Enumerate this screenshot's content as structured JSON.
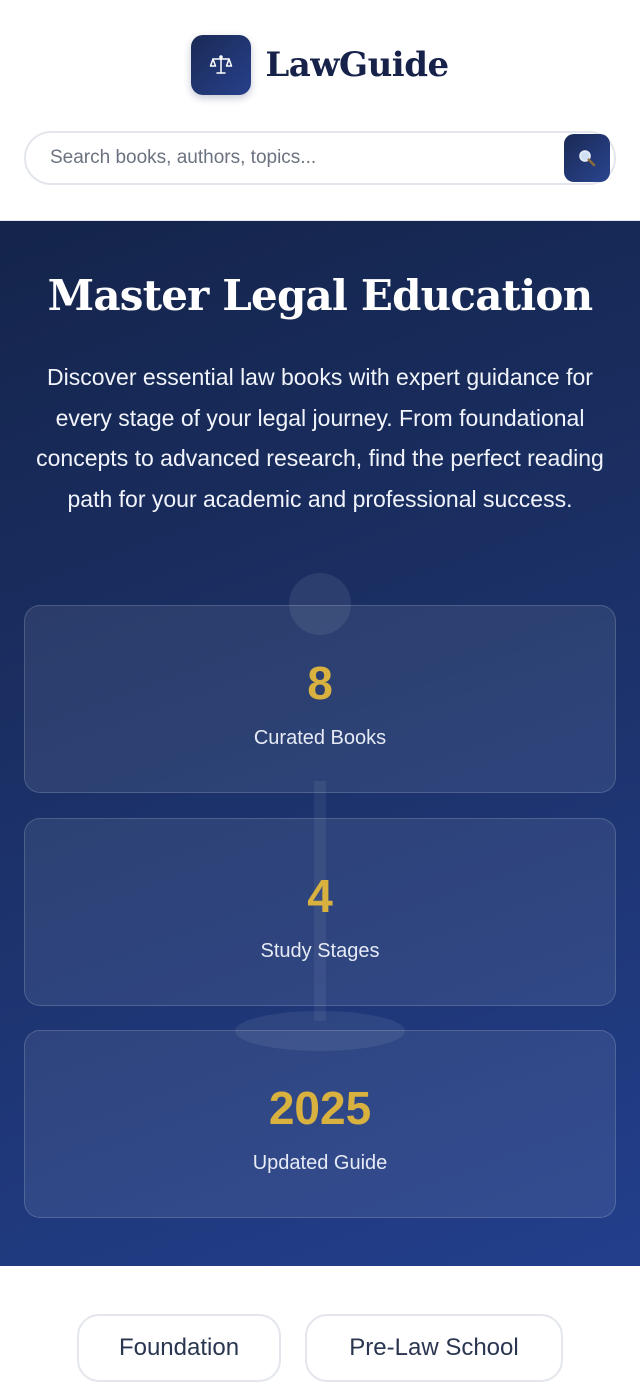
{
  "brand": {
    "name": "LawGuide",
    "logo_icon": "scales-of-justice-icon"
  },
  "search": {
    "placeholder": "Search books, authors, topics...",
    "button_icon": "magnifier-icon"
  },
  "hero": {
    "title": "Master Legal Education",
    "description": "Discover essential law books with expert guidance for every stage of your legal journey. From foundational concepts to advanced research, find the perfect reading path for your academic and professional success."
  },
  "stats": [
    {
      "value": "8",
      "label": "Curated Books"
    },
    {
      "value": "4",
      "label": "Study Stages"
    },
    {
      "value": "2025",
      "label": "Updated Guide"
    }
  ],
  "tabs": [
    {
      "label": "Foundation"
    },
    {
      "label": "Pre-Law School"
    }
  ],
  "colors": {
    "navy": "#17224a",
    "hero_start": "#14244b",
    "hero_end": "#233f8c",
    "gold": "#d8b13f"
  }
}
